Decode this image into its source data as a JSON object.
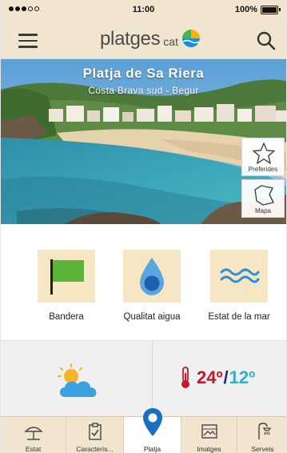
{
  "status_bar": {
    "time": "11:00",
    "battery": "100%"
  },
  "header": {
    "logo_word": "platges",
    "logo_suffix": "cat"
  },
  "beach": {
    "name": "Platja de Sa Riera",
    "location": "Costa Brava sud - Begur"
  },
  "actions": {
    "favorites_label": "Preferides",
    "map_label": "Mapa"
  },
  "features": [
    {
      "label": "Bandera"
    },
    {
      "label": "Qualitat aigua"
    },
    {
      "label": "Estat de la mar"
    }
  ],
  "weather": {
    "max_temp": "24º",
    "separator": "/",
    "min_temp": "12º"
  },
  "tabs": [
    {
      "label": "Estat"
    },
    {
      "label": "Caracterís..."
    },
    {
      "label": "Platja"
    },
    {
      "label": "Imatges"
    },
    {
      "label": "Serveis"
    }
  ],
  "colors": {
    "bar_background": "#f1e5cf",
    "tile_background": "#f6e6c4",
    "flag_green": "#5bb53a",
    "water_blue": "#2a7fd1",
    "max_red": "#c7152c",
    "min_cyan": "#2fb1c9"
  },
  "icons": {
    "menu": "hamburger-icon",
    "search": "search-icon",
    "favorite": "star-icon",
    "map": "map-icon",
    "flag": "flag-icon",
    "water": "water-drop-icon",
    "sea": "waves-icon",
    "weather": "partly-cloudy-icon",
    "thermometer": "thermometer-icon",
    "pin": "location-pin-icon"
  }
}
